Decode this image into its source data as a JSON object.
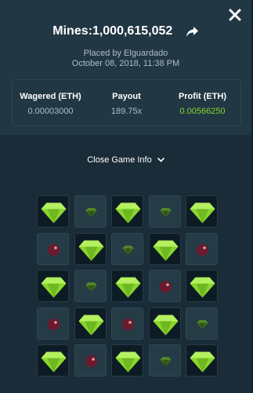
{
  "modal": {
    "title": "Mines:1,000,615,052",
    "placed_by": "Placed by Elguardado",
    "placed_at": "October 08, 2018, 11:38 PM"
  },
  "stats": {
    "wagered": {
      "label": "Wagered (ETH)",
      "value": "0.00003000"
    },
    "payout": {
      "label": "Payout",
      "value": "189.75x"
    },
    "profit": {
      "label": "Profit (ETH)",
      "value": "0.00566250"
    }
  },
  "toggle": {
    "label": "Close Game Info"
  },
  "board": {
    "rows": [
      [
        "gem-revealed",
        "gem",
        "gem-revealed",
        "gem",
        "gem-revealed"
      ],
      [
        "mine",
        "gem-revealed",
        "gem",
        "gem-revealed",
        "mine"
      ],
      [
        "gem-revealed",
        "gem",
        "gem-revealed",
        "mine",
        "gem-revealed"
      ],
      [
        "mine",
        "gem-revealed",
        "mine",
        "gem-revealed",
        "gem"
      ],
      [
        "gem-revealed",
        "mine",
        "gem-revealed",
        "gem",
        "gem-revealed"
      ]
    ]
  },
  "colors": {
    "background": "#1a2c38",
    "header": "#213743",
    "profit_green": "#8ad52e",
    "gem": "#8ad52e",
    "mine": "#6b1a2e",
    "muted_text": "#b1bad3"
  },
  "icons": {
    "close": "close-icon",
    "share": "share-icon",
    "toggle": "chevron-down-icon",
    "gem": "gem-icon",
    "mine": "mine-icon"
  }
}
